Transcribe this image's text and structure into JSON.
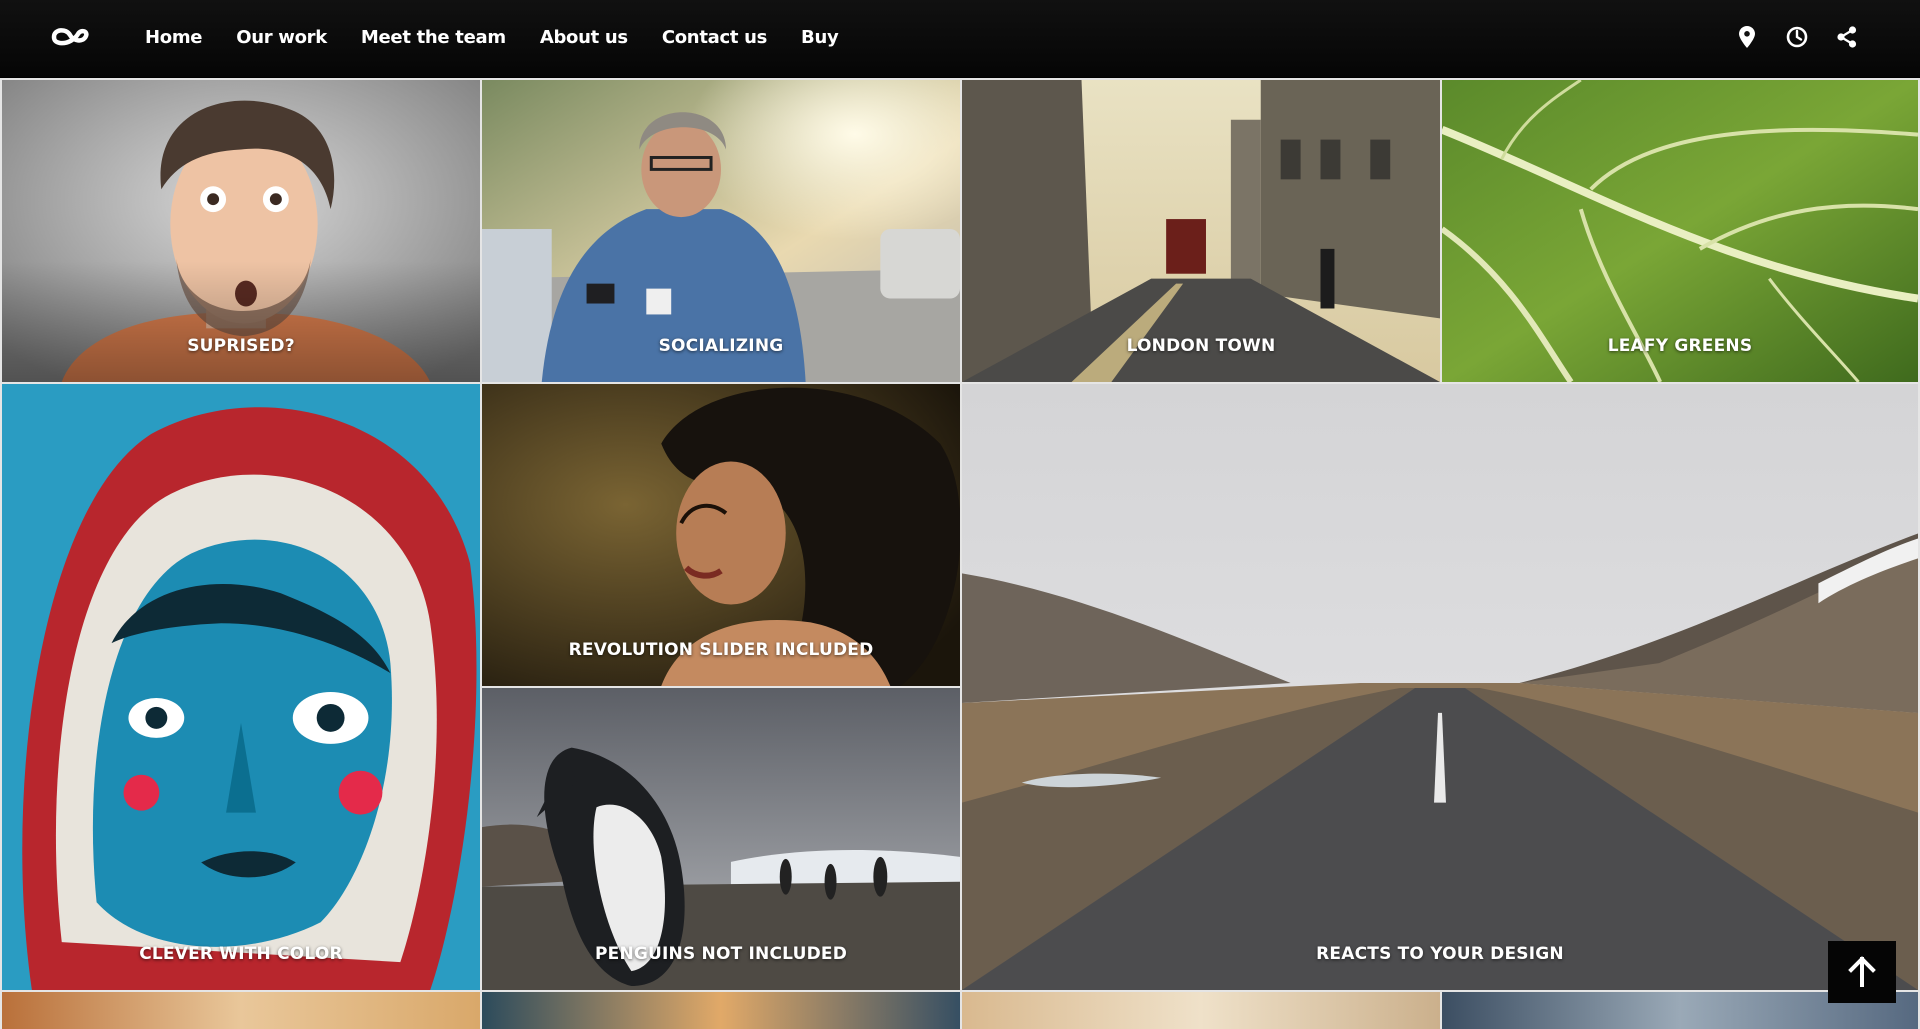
{
  "nav": {
    "items": [
      {
        "label": "Home"
      },
      {
        "label": "Our work"
      },
      {
        "label": "Meet the team"
      },
      {
        "label": "About us"
      },
      {
        "label": "Contact us"
      },
      {
        "label": "Buy"
      }
    ],
    "icons": [
      "map-pin-icon",
      "clock-icon",
      "share-icon"
    ]
  },
  "gallery": {
    "tiles": [
      {
        "caption": "SUPRISED?"
      },
      {
        "caption": "SOCIALIZING"
      },
      {
        "caption": "LONDON TOWN"
      },
      {
        "caption": "LEAFY GREENS"
      },
      {
        "caption": "CLEVER WITH COLOR"
      },
      {
        "caption": "REVOLUTION SLIDER INCLUDED"
      },
      {
        "caption": "REACTS TO YOUR DESIGN"
      },
      {
        "caption": "PENGUINS NOT INCLUDED"
      }
    ]
  },
  "back_to_top": {
    "icon": "arrow-up-icon"
  }
}
